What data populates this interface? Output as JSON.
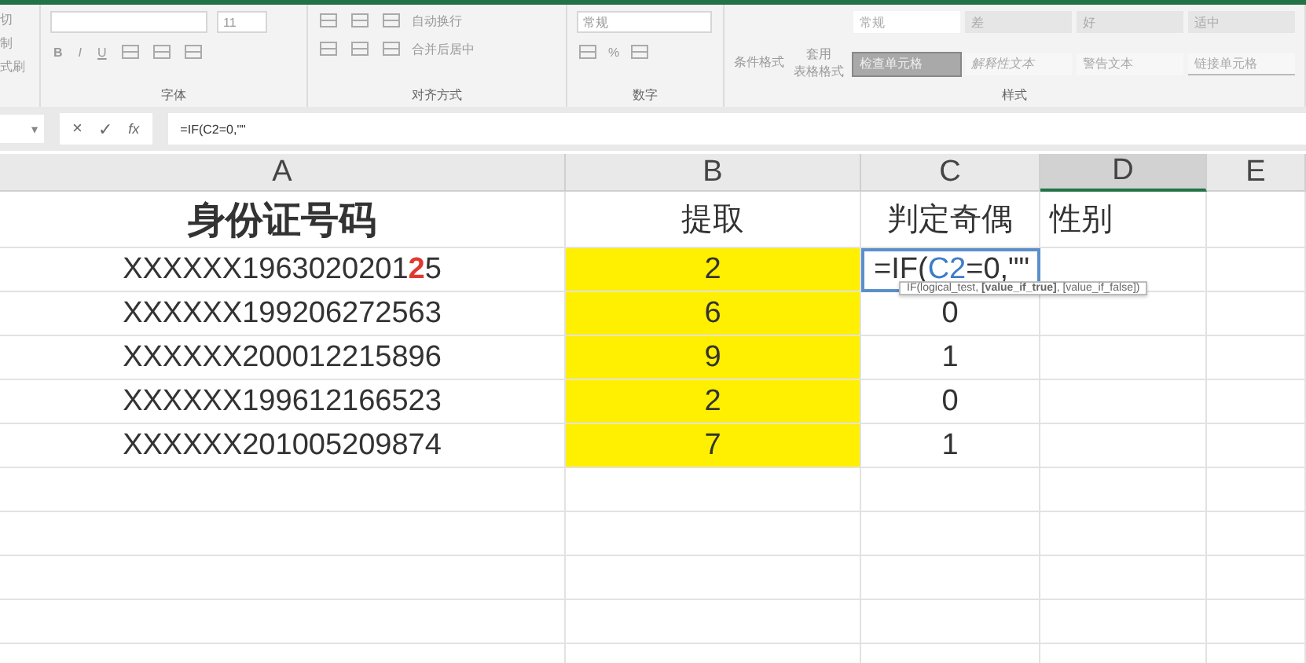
{
  "ribbon": {
    "clipboard": [
      "切",
      "制",
      "式刷"
    ],
    "font": {
      "size": "11",
      "buttons": [
        "B",
        "I",
        "U"
      ],
      "label": "字体"
    },
    "alignment": {
      "wrap": "自动换行",
      "merge": "合并后居中",
      "label": "对齐方式"
    },
    "number": {
      "format": "常规",
      "percent": "%",
      "label": "数字"
    },
    "conditional": "条件格式",
    "table_format": [
      "套用",
      "表格格式"
    ],
    "styles": {
      "label": "样式",
      "cells": [
        {
          "text": "常规",
          "kind": "normal"
        },
        {
          "text": "差",
          "kind": "bad"
        },
        {
          "text": "好",
          "kind": "good"
        },
        {
          "text": "适中",
          "kind": "neutral"
        },
        {
          "text": "检查单元格",
          "kind": "check"
        },
        {
          "text": "解释性文本",
          "kind": "explanatory"
        },
        {
          "text": "警告文本",
          "kind": "warning"
        },
        {
          "text": "链接单元格",
          "kind": "link"
        }
      ]
    }
  },
  "formula_bar": {
    "name_box_arrow": "▾",
    "cancel": "×",
    "enter": "✓",
    "fx": "fx",
    "formula": "=IF(C2=0,\"\""
  },
  "columns": [
    {
      "label": "A",
      "selected": false
    },
    {
      "label": "B",
      "selected": false
    },
    {
      "label": "C",
      "selected": false
    },
    {
      "label": "D",
      "selected": true
    },
    {
      "label": "E",
      "selected": false
    }
  ],
  "header_row": [
    "身份证号码",
    "提取",
    "判定奇偶",
    "性别"
  ],
  "rows": [
    {
      "id": [
        {
          "text": "XXXXXX1963020201",
          "highlight": false
        },
        {
          "text": "2",
          "highlight": true
        },
        {
          "text": "5",
          "highlight": false
        }
      ],
      "digit": "2",
      "digit_filled": true
    },
    {
      "id": [
        {
          "text": "XXXXXX199206272563",
          "highlight": false
        }
      ],
      "digit": "6",
      "digit_filled": true,
      "parity": "0"
    },
    {
      "id": [
        {
          "text": "XXXXXX200012215896",
          "highlight": false
        }
      ],
      "digit": "9",
      "digit_filled": true,
      "parity": "1"
    },
    {
      "id": [
        {
          "text": "XXXXXX199612166523",
          "highlight": false
        }
      ],
      "digit": "2",
      "digit_filled": true,
      "parity": "0"
    },
    {
      "id": [
        {
          "text": "XXXXXX201005209874",
          "highlight": false
        }
      ],
      "digit": "7",
      "digit_filled": true,
      "parity": "1"
    }
  ],
  "active_cell": {
    "parts": [
      {
        "text": "=IF(",
        "kind": "plain"
      },
      {
        "text": "C2",
        "kind": "ref"
      },
      {
        "text": "=0,\"\"",
        "kind": "plain"
      }
    ],
    "tooltip": "IF(logical_test, **[value_if_true]**, [value_if_false])"
  }
}
